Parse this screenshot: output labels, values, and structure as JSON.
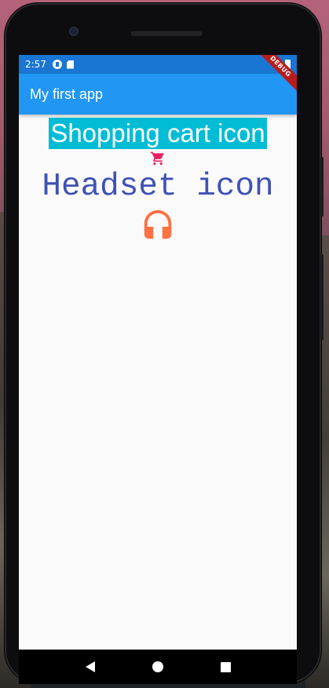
{
  "status_bar": {
    "time": "2:57",
    "debug_banner": "DEBUG"
  },
  "app_bar": {
    "title": "My first app"
  },
  "content": {
    "shopping_cart_text": "Shopping cart icon",
    "shopping_cart_icon": "shopping-cart-icon",
    "shopping_cart_icon_color": "#e91e63",
    "shopping_cart_text_bg": "#00bcd4",
    "headset_text": "Headset icon",
    "headset_text_color": "#3f51b5",
    "headset_icon": "headset-icon",
    "headset_icon_color": "#ff7043"
  },
  "nav_bar": {
    "back": "back-icon",
    "home": "home-icon",
    "recents": "recents-icon"
  },
  "colors": {
    "status_bar": "#1976d2",
    "app_bar": "#2196f3",
    "background": "#fafafa"
  }
}
